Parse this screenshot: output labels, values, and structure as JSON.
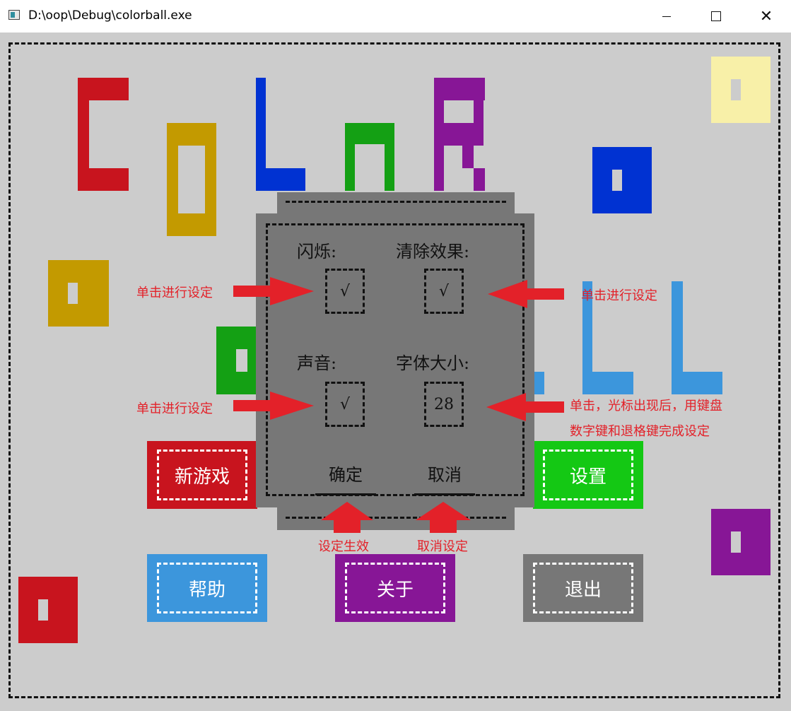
{
  "window": {
    "title": "D:\\oop\\Debug\\colorball.exe"
  },
  "settings": {
    "flash_label": "闪烁:",
    "flash_value": "√",
    "clear_effect_label": "清除效果:",
    "clear_effect_value": "√",
    "sound_label": "声音:",
    "sound_value": "√",
    "font_size_label": "字体大小:",
    "font_size_value": "28",
    "confirm_label": "确定",
    "cancel_label": "取消"
  },
  "menu": {
    "new_game": "新游戏",
    "settings": "设置",
    "help": "帮助",
    "about": "关于",
    "exit": "退出"
  },
  "annotations": {
    "flash_hint": "单击进行设定",
    "clear_hint": "单击进行设定",
    "sound_hint": "单击进行设定",
    "font_hint_line1": "单击，光标出现后，用键盘",
    "font_hint_line2": "数字键和退格键完成设定",
    "confirm_hint": "设定生效",
    "cancel_hint": "取消设定"
  },
  "colors": {
    "red": "#c8141e",
    "gold": "#c39a00",
    "blue": "#0032d2",
    "green": "#14a014",
    "purple": "#871696",
    "light_blue": "#3c96dc",
    "pale_yellow": "#f8f0a8",
    "gray_panel": "#777777",
    "bright_green": "#14c814",
    "annotation_red": "#e32129"
  }
}
